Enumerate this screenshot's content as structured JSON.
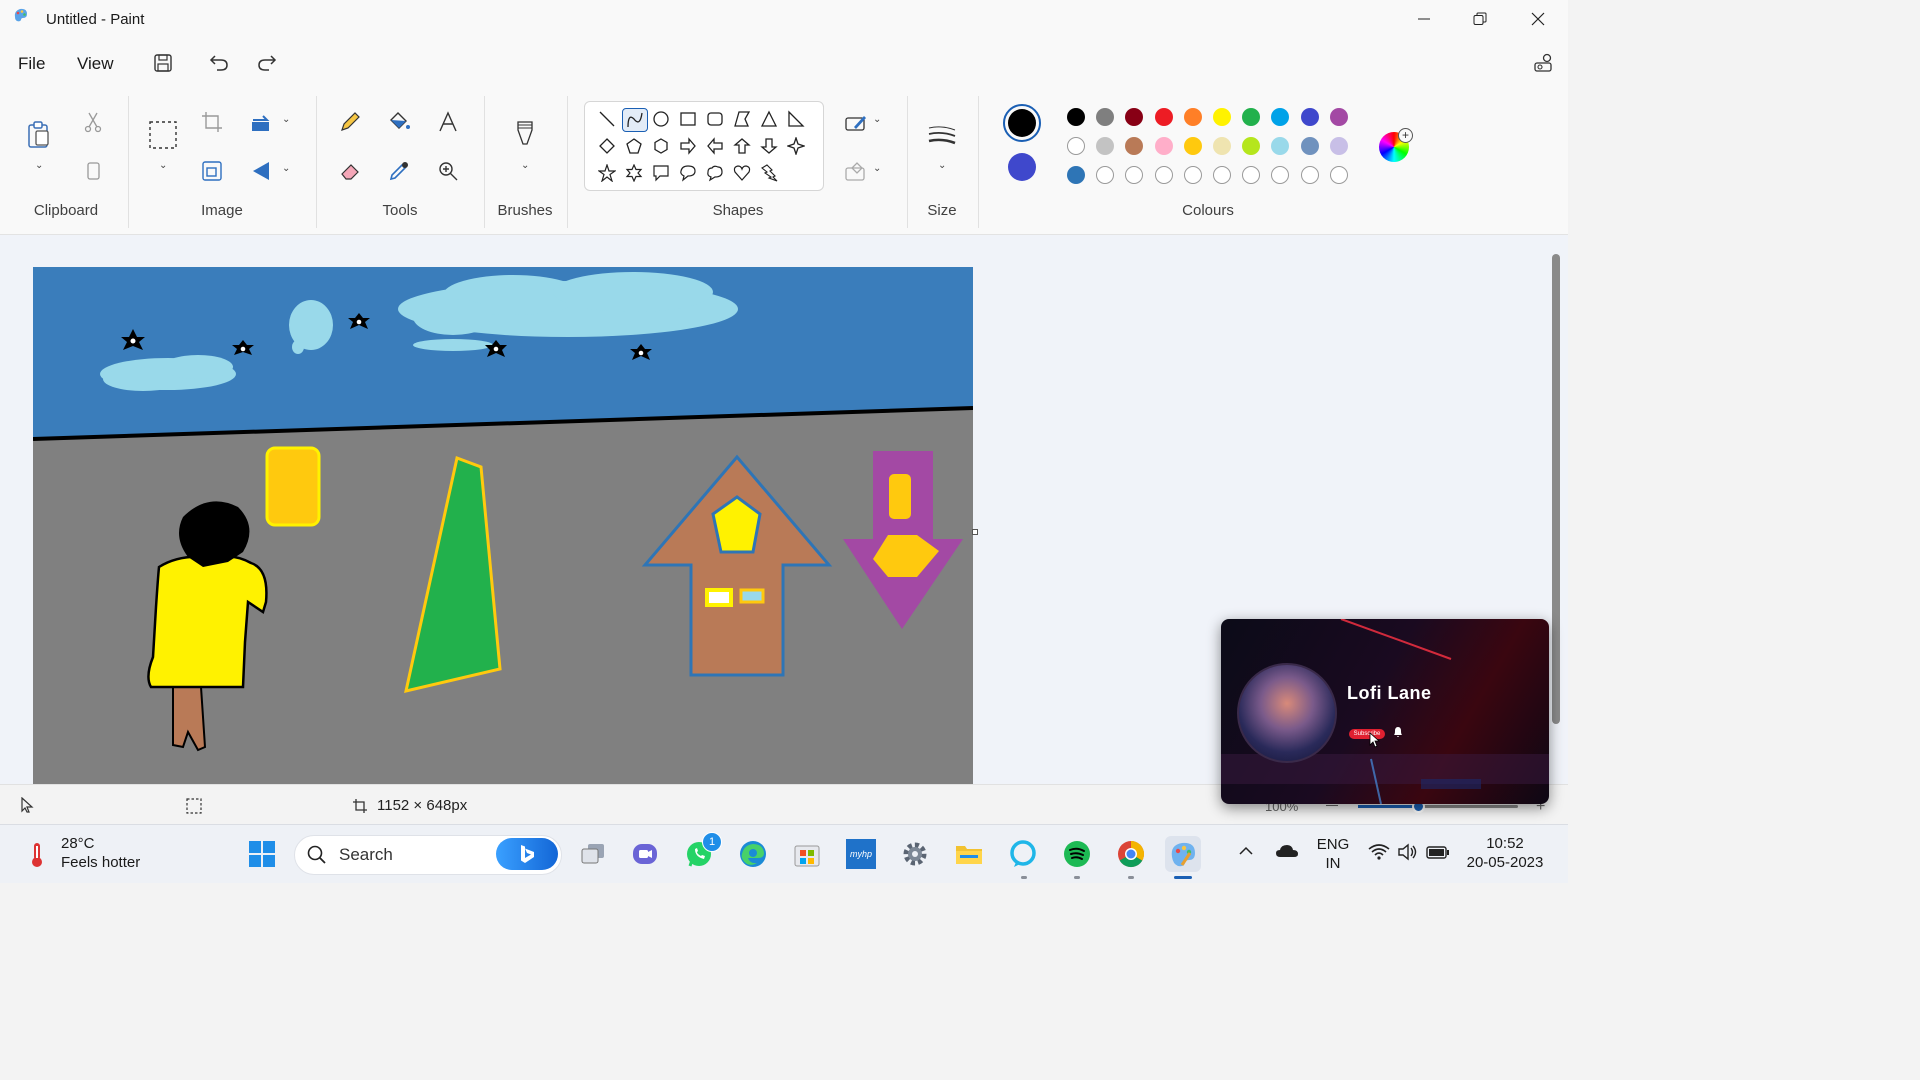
{
  "window": {
    "title": "Untitled - Paint"
  },
  "menu": {
    "file": "File",
    "view": "View"
  },
  "ribbon": {
    "groups": {
      "clipboard": "Clipboard",
      "image": "Image",
      "tools": "Tools",
      "brushes": "Brushes",
      "shapes": "Shapes",
      "size": "Size",
      "colours": "Colours"
    },
    "primary_color": "#000000",
    "secondary_color": "#3f48cc",
    "palette_row1": [
      "#000000",
      "#7f7f7f",
      "#880015",
      "#ed1c24",
      "#ff7f27",
      "#fff200",
      "#22b14c",
      "#00a2e8",
      "#3f48cc",
      "#a349a4"
    ],
    "palette_row2": [
      "#ffffff",
      "#c3c3c3",
      "#b97a57",
      "#ffaec9",
      "#ffc90e",
      "#efe4b0",
      "#b5e61d",
      "#99d9ea",
      "#7092be",
      "#c8bfe7"
    ],
    "palette_row3_first": "#2e75b6"
  },
  "status": {
    "canvas_size": "1152 × 648px",
    "zoom": "100%"
  },
  "miniplayer": {
    "channel": "Lofi Lane",
    "subscribe": "Subscribe"
  },
  "taskbar": {
    "weather_temp": "28°C",
    "weather_desc": "Feels hotter",
    "search_placeholder": "Search",
    "whatsapp_badge": "1",
    "lang": "ENG",
    "region": "IN",
    "time": "10:52",
    "date": "20-05-2023"
  }
}
